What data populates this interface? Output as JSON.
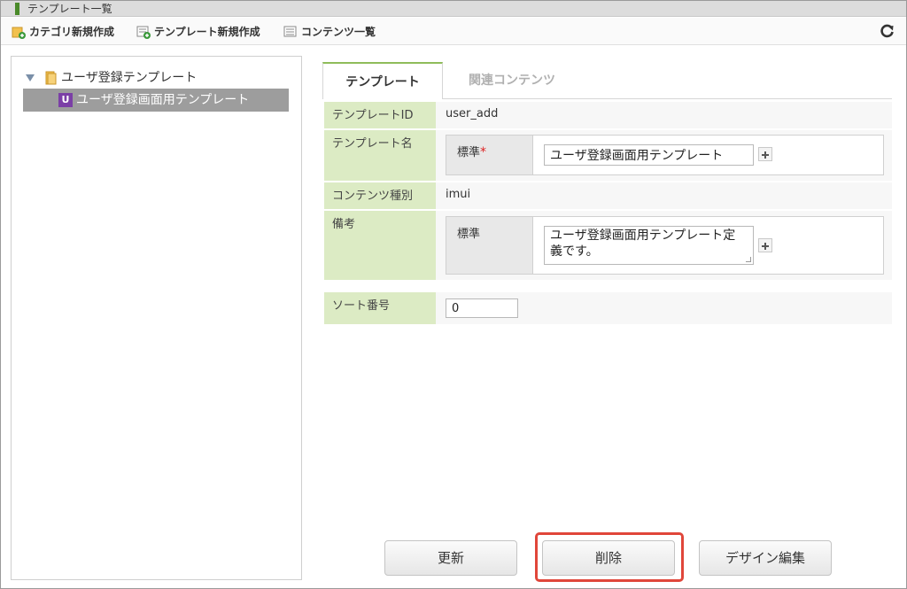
{
  "window": {
    "title": "テンプレート一覧"
  },
  "toolbar": {
    "category_new": "カテゴリ新規作成",
    "template_new": "テンプレート新規作成",
    "contents_list": "コンテンツ一覧"
  },
  "tree": {
    "root_label": "ユーザ登録テンプレート",
    "child_badge": "U",
    "child_label": "ユーザ登録画面用テンプレート"
  },
  "tabs": [
    {
      "label": "テンプレート",
      "active": true
    },
    {
      "label": "関連コンテンツ",
      "active": false
    }
  ],
  "form": {
    "template_id": {
      "label": "テンプレートID",
      "value": "user_add"
    },
    "template_name": {
      "label": "テンプレート名",
      "lang_label": "標準",
      "required_mark": "*",
      "value": "ユーザ登録画面用テンプレート"
    },
    "content_type": {
      "label": "コンテンツ種別",
      "value": "imui"
    },
    "remarks": {
      "label": "備考",
      "lang_label": "標準",
      "value": "ユーザ登録画面用テンプレート定義です。"
    },
    "sort_no": {
      "label": "ソート番号",
      "value": "0"
    }
  },
  "buttons": {
    "update": "更新",
    "delete": "削除",
    "design_edit": "デザイン編集"
  },
  "colors": {
    "label_bg": "#dcebc4",
    "tab_accent": "#8fbc5a",
    "highlight": "#e0463a",
    "badge": "#7b3fa6"
  }
}
